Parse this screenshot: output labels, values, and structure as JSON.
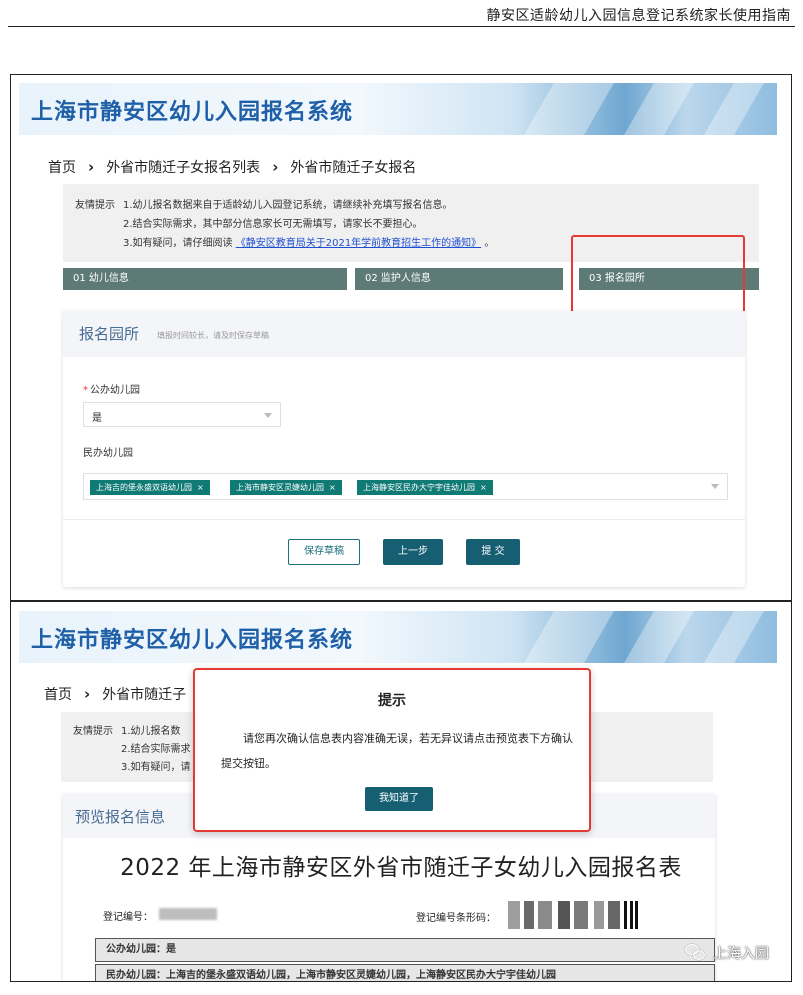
{
  "doc_header": {
    "title": "静安区适龄幼儿入园信息登记系统家长使用指南"
  },
  "system_title": "上海市静安区幼儿入园报名系统",
  "top": {
    "breadcrumb": [
      "首页",
      "外省市随迁子女报名列表",
      "外省市随迁子女报名"
    ],
    "tips": {
      "prefix": "友情提示",
      "line1": "1.幼儿报名数据来自于适龄幼儿入园登记系统，请继续补充填写报名信息。",
      "line2": "2.结合实际需求，其中部分信息家长可无需填写，请家长不要担心。",
      "line3_before": "3.如有疑问，请仔细阅读",
      "line3_link": "《静安区教育局关于2021年学前教育招生工作的通知》",
      "line3_after": "。"
    },
    "steps": [
      "01 幼儿信息",
      "02 监护人信息",
      "03 报名园所"
    ],
    "card": {
      "title": "报名园所",
      "subtitle": "填报时间较长，请及时保存草稿",
      "public_label": "公办幼儿园",
      "public_required": "*",
      "public_value": "是",
      "private_label": "民办幼儿园",
      "tags": [
        "上海吉的堡永盛双语幼儿园",
        "上海市静安区灵婕幼儿园",
        "上海静安区民办大宁宇佳幼儿园"
      ],
      "tag_close": "×"
    },
    "buttons": {
      "save_draft": "保存草稿",
      "prev": "上一步",
      "submit": "提 交"
    }
  },
  "bottom": {
    "breadcrumb": [
      "首页",
      "外省市随迁子"
    ],
    "tips": {
      "prefix": "友情提示",
      "line1": "1.幼儿报名数",
      "line2": "2.结合实际需求",
      "line3": "3.如有疑问，请"
    },
    "preview_title": "预览报名信息",
    "form_title": "2022 年上海市静安区外省市随迁子女幼儿入园报名表",
    "reg_no_label": "登记编号：",
    "barcode_label": "登记编号条形码：",
    "public_row": "公办幼儿园：是",
    "private_row": "民办幼儿园：上海吉的堡永盛双语幼儿园，上海市静安区灵婕幼儿园，上海静安区民办大宁宇佳幼儿园",
    "modal": {
      "title": "提示",
      "text": "请您再次确认信息表内容准确无误，若无异议请点击预览表下方确认提交按钮。",
      "button": "我知道了"
    }
  },
  "watermark": {
    "text": "上海入园",
    "icon": "wechat-icon"
  }
}
